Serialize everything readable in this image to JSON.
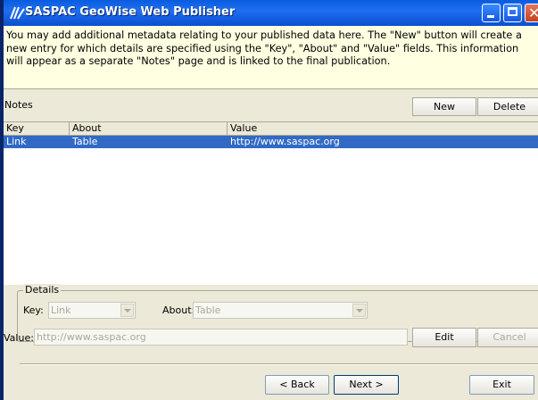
{
  "window": {
    "title": "SASPAC GeoWise Web Publisher",
    "intro_text": "You may add additional metadata relating to your published data here. The \"New\" button will create a new entry for which details are specified using the \"Key\", \"About\" and \"Value\" fields. This information will appear as a separate \"Notes\" page and is linked to the final publication."
  },
  "notes": {
    "label": "Notes",
    "new_label": "New",
    "delete_label": "Delete",
    "columns": [
      "Key",
      "About",
      "Value"
    ],
    "rows": [
      {
        "key": "Link",
        "about": "Table",
        "value": "http://www.saspac.org"
      }
    ]
  },
  "details": {
    "legend": "Details",
    "key_label": "Key:",
    "key_value": "Link",
    "about_label": "About:",
    "about_value": "Table",
    "value_label": "Value:",
    "value_value": "http://www.saspac.org",
    "edit_label": "Edit",
    "cancel_label": "Cancel"
  },
  "footer": {
    "back_label": "< Back",
    "next_label": "Next >",
    "exit_label": "Exit"
  },
  "colors": {
    "selection": "#316ac5",
    "info_background": "#ffffe1",
    "titlebar": "#0a5bdf"
  }
}
